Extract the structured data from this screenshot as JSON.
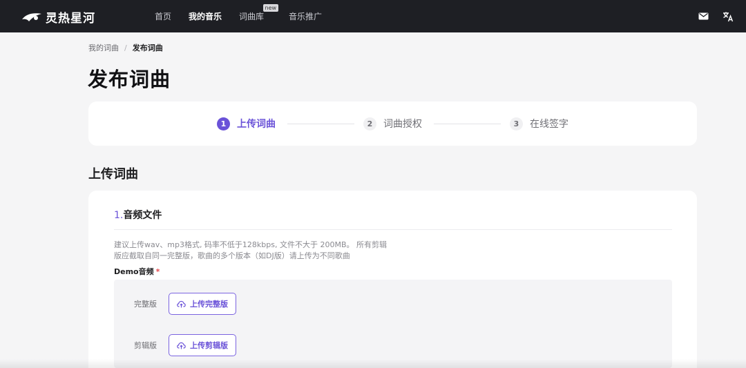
{
  "app": {
    "brand": "灵热星河"
  },
  "nav": {
    "items": [
      {
        "label": "首页"
      },
      {
        "label": "我的音乐"
      },
      {
        "label": "词曲库",
        "badge": "new"
      },
      {
        "label": "音乐推广"
      }
    ]
  },
  "top_icons": [
    "mail-icon",
    "translate-icon"
  ],
  "breadcrumb": {
    "parent": "我的词曲",
    "separator": "/",
    "current": "发布词曲"
  },
  "page": {
    "title": "发布词曲"
  },
  "steps": [
    {
      "num": "1",
      "label": "上传词曲",
      "active": true
    },
    {
      "num": "2",
      "label": "词曲授权",
      "active": false
    },
    {
      "num": "3",
      "label": "在线签字",
      "active": false
    }
  ],
  "section": {
    "heading": "上传词曲"
  },
  "upload": {
    "index": "1.",
    "title": "音频文件",
    "hint_line1": "建议上传wav、mp3格式, 码率不低于128kbps, 文件不大于 200MB。 所有剪辑",
    "hint_line2": "版应截取自同一完整版，歌曲的多个版本（如DJ版）请上传为不同歌曲",
    "demo_label": "Demo音频",
    "required_mark": "*",
    "rows": [
      {
        "label": "完整版",
        "button": "上传完整版"
      },
      {
        "label": "剪辑版",
        "button": "上传剪辑版"
      }
    ]
  },
  "colors": {
    "accent": "#6a52d8",
    "topbar": "#1e1f24",
    "background": "#f5f5f6"
  }
}
